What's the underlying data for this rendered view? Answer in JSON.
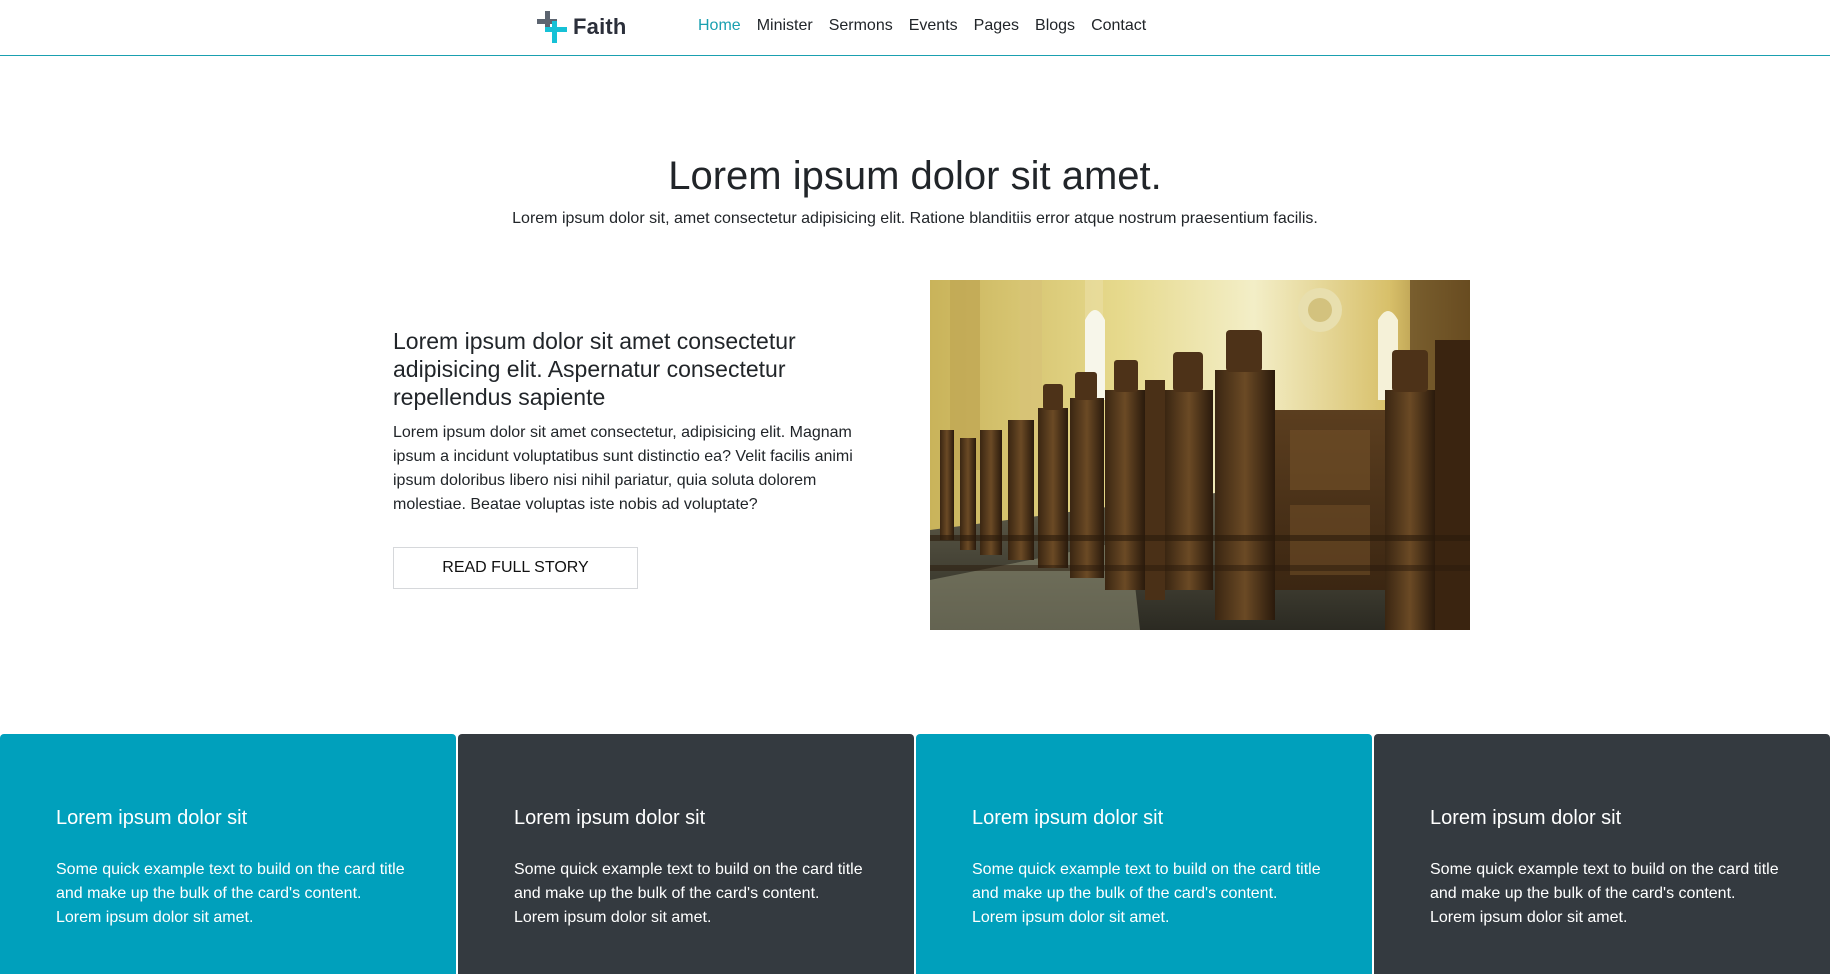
{
  "navbar": {
    "brand_name": "Faith",
    "brand_icon": "cross-logo-icon",
    "accent_color": "#1aa0b0",
    "links": [
      {
        "label": "Home",
        "active": true
      },
      {
        "label": "Minister",
        "active": false
      },
      {
        "label": "Sermons",
        "active": false
      },
      {
        "label": "Events",
        "active": false
      },
      {
        "label": "Pages",
        "active": false
      },
      {
        "label": "Blogs",
        "active": false
      },
      {
        "label": "Contact",
        "active": false
      }
    ]
  },
  "hero": {
    "title": "Lorem ipsum dolor sit amet.",
    "lead": "Lorem ipsum dolor sit, amet consectetur adipisicing elit. Ratione blanditiis error atque nostrum praesentium facilis."
  },
  "story": {
    "heading": "Lorem ipsum dolor sit amet consectetur adipisicing elit. Aspernatur consectetur repellendus sapiente",
    "text": "Lorem ipsum dolor sit amet consectetur, adipisicing elit. Magnam ipsum a incidunt voluptatibus sunt distinctio ea? Velit facilis animi ipsum doloribus libero nisi nihil pariatur, quia soluta dolorem molestiae. Beatae voluptas iste nobis ad voluptate?",
    "button_label": "READ FULL STORY",
    "image_subject": "church-pews-photo"
  },
  "cards": [
    {
      "title": "Lorem ipsum dolor sit",
      "text": "Some quick example text to build on the card title and make up the bulk of the card's content. Lorem ipsum dolor sit amet.",
      "color": "#00a0bc"
    },
    {
      "title": "Lorem ipsum dolor sit",
      "text": "Some quick example text to build on the card title and make up the bulk of the card's content. Lorem ipsum dolor sit amet.",
      "color": "#343a40"
    },
    {
      "title": "Lorem ipsum dolor sit",
      "text": "Some quick example text to build on the card title and make up the bulk of the card's content. Lorem ipsum dolor sit amet.",
      "color": "#00a0bc"
    },
    {
      "title": "Lorem ipsum dolor sit",
      "text": "Some quick example text to build on the card title and make up the bulk of the card's content. Lorem ipsum dolor sit amet.",
      "color": "#343a40"
    }
  ]
}
